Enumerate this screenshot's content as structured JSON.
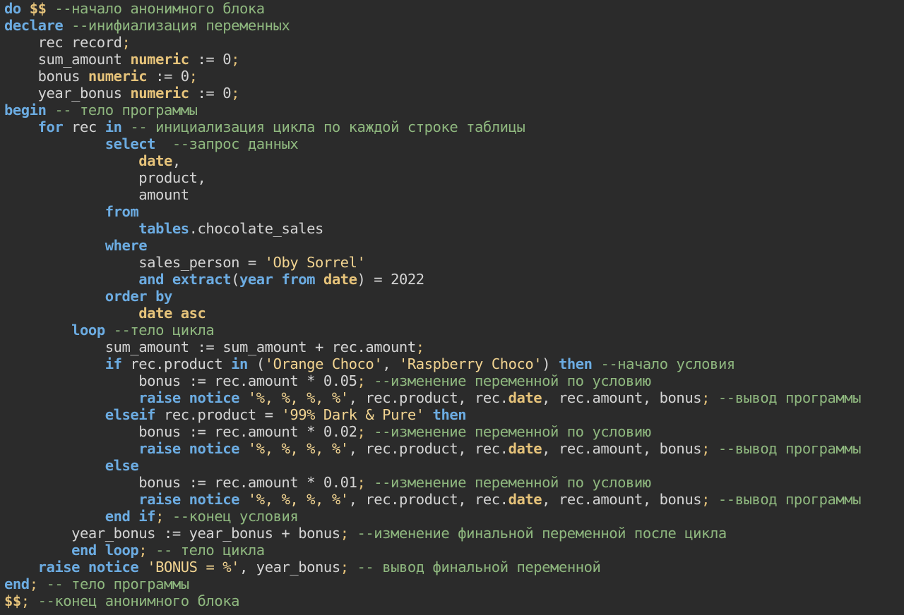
{
  "editor": {
    "name": "sql-code-editor",
    "lines": [
      [
        [
          "kw",
          "do "
        ],
        [
          "type",
          "$$"
        ],
        [
          "comment",
          " --начало анонимного блока"
        ]
      ],
      [
        [
          "kw",
          "declare"
        ],
        [
          "comment",
          " --инифиализация переменных"
        ]
      ],
      [
        [
          "ident",
          "    rec record"
        ],
        [
          "punct",
          ";"
        ]
      ],
      [
        [
          "ident",
          "    sum_amount "
        ],
        [
          "type",
          "numeric"
        ],
        [
          "ident",
          " := 0"
        ],
        [
          "punct",
          ";"
        ]
      ],
      [
        [
          "ident",
          "    bonus "
        ],
        [
          "type",
          "numeric"
        ],
        [
          "ident",
          " := 0"
        ],
        [
          "punct",
          ";"
        ]
      ],
      [
        [
          "ident",
          "    year_bonus "
        ],
        [
          "type",
          "numeric"
        ],
        [
          "ident",
          " := 0"
        ],
        [
          "punct",
          ";"
        ]
      ],
      [
        [
          "kw",
          "begin"
        ],
        [
          "comment",
          " -- тело программы"
        ]
      ],
      [
        [
          "ident",
          "    "
        ],
        [
          "kw",
          "for"
        ],
        [
          "ident",
          " rec "
        ],
        [
          "kw",
          "in"
        ],
        [
          "comment",
          " -- инициализация цикла по каждой строке таблицы"
        ]
      ],
      [
        [
          "ident",
          "            "
        ],
        [
          "kw",
          "select"
        ],
        [
          "comment",
          "  --запрос данных"
        ]
      ],
      [
        [
          "ident",
          "                "
        ],
        [
          "type",
          "date"
        ],
        [
          "ident",
          ","
        ]
      ],
      [
        [
          "ident",
          "                product,"
        ]
      ],
      [
        [
          "ident",
          "                amount"
        ]
      ],
      [
        [
          "ident",
          "            "
        ],
        [
          "kw",
          "from"
        ]
      ],
      [
        [
          "ident",
          "                "
        ],
        [
          "kw",
          "tables"
        ],
        [
          "ident",
          ".chocolate_sales"
        ]
      ],
      [
        [
          "ident",
          "            "
        ],
        [
          "kw",
          "where"
        ]
      ],
      [
        [
          "ident",
          "                sales_person = "
        ],
        [
          "str",
          "'Oby Sorrel'"
        ]
      ],
      [
        [
          "ident",
          "                "
        ],
        [
          "kw",
          "and extract"
        ],
        [
          "ident",
          "("
        ],
        [
          "kw",
          "year from "
        ],
        [
          "type",
          "date"
        ],
        [
          "ident",
          ") = 2022"
        ]
      ],
      [
        [
          "ident",
          "            "
        ],
        [
          "kw",
          "order by"
        ]
      ],
      [
        [
          "ident",
          "                "
        ],
        [
          "type",
          "date asc"
        ]
      ],
      [
        [
          "ident",
          "        "
        ],
        [
          "kw",
          "loop"
        ],
        [
          "comment",
          " --тело цикла"
        ]
      ],
      [
        [
          "ident",
          "            sum_amount := sum_amount + rec.amount"
        ],
        [
          "punct",
          ";"
        ]
      ],
      [
        [
          "ident",
          "            "
        ],
        [
          "kw",
          "if"
        ],
        [
          "ident",
          " rec.product "
        ],
        [
          "kw",
          "in"
        ],
        [
          "ident",
          " ("
        ],
        [
          "str",
          "'Orange Choco'"
        ],
        [
          "ident",
          ", "
        ],
        [
          "str",
          "'Raspberry Choco'"
        ],
        [
          "ident",
          ") "
        ],
        [
          "kw",
          "then"
        ],
        [
          "comment",
          " --начало условия"
        ]
      ],
      [
        [
          "ident",
          "                bonus := rec.amount * 0.05"
        ],
        [
          "punct",
          ";"
        ],
        [
          "comment",
          " --изменение переменной по условию"
        ]
      ],
      [
        [
          "ident",
          "                "
        ],
        [
          "kw",
          "raise notice"
        ],
        [
          "ident",
          " "
        ],
        [
          "str",
          "'%, %, %, %'"
        ],
        [
          "ident",
          ", rec.product, rec."
        ],
        [
          "type",
          "date"
        ],
        [
          "ident",
          ", rec.amount, bonus"
        ],
        [
          "punct",
          ";"
        ],
        [
          "comment",
          " --вывод программы"
        ]
      ],
      [
        [
          "ident",
          "            "
        ],
        [
          "kw",
          "elseif"
        ],
        [
          "ident",
          " rec.product = "
        ],
        [
          "str",
          "'99% Dark & Pure'"
        ],
        [
          "ident",
          " "
        ],
        [
          "kw",
          "then"
        ]
      ],
      [
        [
          "ident",
          "                bonus := rec.amount * 0.02"
        ],
        [
          "punct",
          ";"
        ],
        [
          "comment",
          " --изменение переменной по условию"
        ]
      ],
      [
        [
          "ident",
          "                "
        ],
        [
          "kw",
          "raise notice"
        ],
        [
          "ident",
          " "
        ],
        [
          "str",
          "'%, %, %, %'"
        ],
        [
          "ident",
          ", rec.product, rec."
        ],
        [
          "type",
          "date"
        ],
        [
          "ident",
          ", rec.amount, bonus"
        ],
        [
          "punct",
          ";"
        ],
        [
          "comment",
          " --вывод программы"
        ]
      ],
      [
        [
          "ident",
          "            "
        ],
        [
          "kw",
          "else"
        ]
      ],
      [
        [
          "ident",
          "                bonus := rec.amount * 0.01"
        ],
        [
          "punct",
          ";"
        ],
        [
          "comment",
          " --изменение переменной по условию"
        ]
      ],
      [
        [
          "ident",
          "                "
        ],
        [
          "kw",
          "raise notice"
        ],
        [
          "ident",
          " "
        ],
        [
          "str",
          "'%, %, %, %'"
        ],
        [
          "ident",
          ", rec.product, rec."
        ],
        [
          "type",
          "date"
        ],
        [
          "ident",
          ", rec.amount, bonus"
        ],
        [
          "punct",
          ";"
        ],
        [
          "comment",
          " --вывод программы"
        ]
      ],
      [
        [
          "ident",
          "            "
        ],
        [
          "kw",
          "end if"
        ],
        [
          "punct",
          ";"
        ],
        [
          "comment",
          " --конец условия"
        ]
      ],
      [
        [
          "ident",
          "        year_bonus := year_bonus + bonus"
        ],
        [
          "punct",
          ";"
        ],
        [
          "comment",
          " --изменение финальной переменной после цикла"
        ]
      ],
      [
        [
          "ident",
          "        "
        ],
        [
          "kw",
          "end loop"
        ],
        [
          "punct",
          ";"
        ],
        [
          "comment",
          " -- тело цикла"
        ]
      ],
      [
        [
          "ident",
          "    "
        ],
        [
          "kw",
          "raise notice"
        ],
        [
          "ident",
          " "
        ],
        [
          "str",
          "'BONUS = %'"
        ],
        [
          "ident",
          ", year_bonus"
        ],
        [
          "punct",
          ";"
        ],
        [
          "comment",
          " -- вывод финальной переменной"
        ]
      ],
      [
        [
          "kw",
          "end"
        ],
        [
          "punct",
          ";"
        ],
        [
          "comment",
          " -- тело программы"
        ]
      ],
      [
        [
          "type",
          "$$"
        ],
        [
          "punct",
          ";"
        ],
        [
          "comment",
          " --конец анонимного блока"
        ]
      ]
    ]
  },
  "colors": {
    "background": "#2b2b2b",
    "keyword": "#6cace2",
    "type": "#e6c37a",
    "identifier": "#d4d4d4",
    "string": "#f2d491",
    "comment": "#8fb87f"
  }
}
